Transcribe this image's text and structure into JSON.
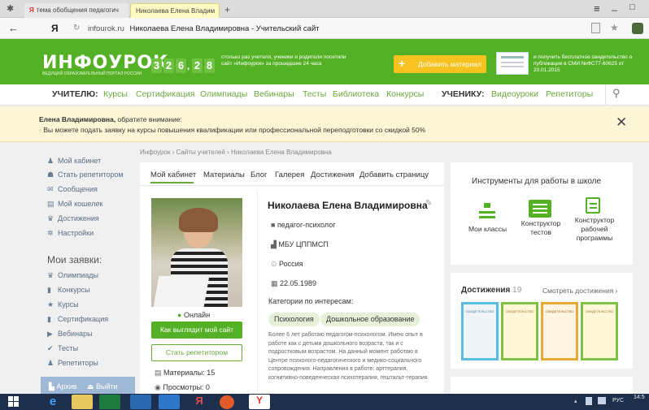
{
  "browser": {
    "tab1": "тема обобщения педагогич",
    "tab2": "Николаева Елена Владим",
    "tab_new": "+",
    "url_host": "infourok.ru",
    "url_title": "Николаева Елена Владимировна - Учительский сайт",
    "yandex": "Я",
    "window_menu": "≡",
    "minimize": "_",
    "maximize": "□"
  },
  "header": {
    "logo": "ИНФОУРОК",
    "logo_sub": "ВЕДУЩИЙ ОБРАЗОВАТЕЛЬНЫЙ ПОРТАЛ РОССИИ",
    "counter_digits": [
      "3",
      "2",
      "6",
      "2",
      "8",
      "1"
    ],
    "counter_sep": ",",
    "counter_text": "столько раз учителя, ученики и родители посетили сайт «Инфоурок» за прошедшие 24 часа",
    "add_material": "Добавить материал",
    "cert_text": "и получить бесплатное свидетельство о публикации в СМИ №ФС77-60625 от 20.01.2015"
  },
  "nav": {
    "teacher_head": "УЧИТЕЛЮ:",
    "teacher_links": [
      "Курсы",
      "Сертификация",
      "Олимпиады",
      "Вебинары",
      "Тесты",
      "Библиотека",
      "Конкурсы"
    ],
    "student_head": "УЧЕНИКУ:",
    "student_links": [
      "Видеоуроки",
      "Репетиторы"
    ]
  },
  "notice": {
    "title": "Елена Владимировна,",
    "title_rest": " обратите внимание:",
    "text": "Вы можете подать заявку на курсы повышения квалификации или профессиональной переподготовки со скидкой 50%",
    "close": "✕"
  },
  "left_menu": {
    "items": [
      "Мой кабинет",
      "Стать репетитором",
      "Сообщения",
      "Мой кошелек",
      "Достижения",
      "Настройки"
    ],
    "requests_title": "Мои заявки:",
    "requests": [
      "Олимпиады",
      "Конкурсы",
      "Курсы",
      "Сертификация",
      "Вебинары",
      "Тесты",
      "Репетиторы"
    ],
    "bottom": [
      "Архив",
      "Выйти"
    ]
  },
  "breadcrumb": "Инфоурок › Сайты учителей › Николаева Елена Владимировна",
  "tabs": [
    "Мой кабинет",
    "Материалы",
    "Блог",
    "Галерея",
    "Достижения",
    "Добавить страницу"
  ],
  "profile": {
    "status": "Онлайн",
    "view_button": "Как выглядит мой сайт",
    "tutor_button": "Стать репетитором",
    "materials": "Материалы: 15",
    "views": "Просмотры: 0",
    "name": "Николаева Елена Владимировна",
    "position": "педагог-психолог",
    "org": "МБУ ЦППМСП",
    "country": "Россия",
    "birthdate": "22.05.1989",
    "interests_title": "Категории по интересам:",
    "interests": [
      "Психология",
      "Дошкольное образование"
    ],
    "bio": "Более 6 лет работаю педагогом-психологом. Имею опыт в работе как с детьми дошкольного возраста, так и с подростковым возрастом. На данный момент работаю в Центре психолого-педагогического и медико-социального сопровождения. Направления в работе: арттерапия, когнитивно-поведенческая психотерапия, гештальт-терапия."
  },
  "tools": {
    "title": "Инструменты для работы в школе",
    "items": [
      "Мои классы",
      "Конструктор тестов",
      "Конструктор рабочей программы"
    ]
  },
  "achievements": {
    "title": "Достижения",
    "count": "19",
    "link": "Смотреть достижения ›",
    "cert_label": "СВИДЕТЕЛЬСТВО"
  },
  "taskbar": {
    "lang": "РУС",
    "time": "14:5"
  },
  "colors": {
    "brand_green": "#54b125",
    "link_green": "#6aa93c",
    "button_yellow": "#f6c21f",
    "notice_bg": "#fdf6d6"
  }
}
